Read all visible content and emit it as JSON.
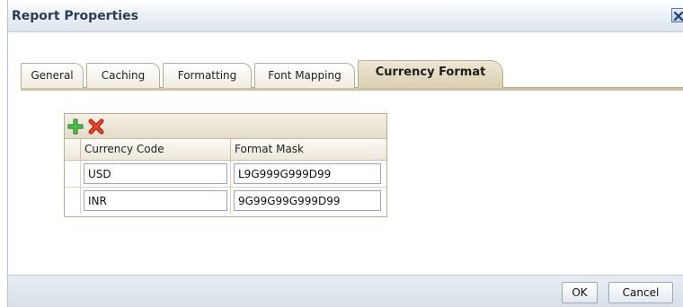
{
  "dialog": {
    "title": "Report Properties",
    "close_icon": "close-icon"
  },
  "tabs": [
    {
      "label": "General",
      "active": false
    },
    {
      "label": "Caching",
      "active": false
    },
    {
      "label": "Formatting",
      "active": false
    },
    {
      "label": "Font Mapping",
      "active": false
    },
    {
      "label": "Currency Format",
      "active": true
    }
  ],
  "grid": {
    "toolbar": {
      "add_icon": "add-icon",
      "delete_icon": "delete-icon"
    },
    "columns": [
      "Currency Code",
      "Format Mask"
    ],
    "rows": [
      {
        "currency_code": "USD",
        "format_mask": "L9G999G999D99"
      },
      {
        "currency_code": "INR",
        "format_mask": "9G99G99G999D99"
      }
    ]
  },
  "footer": {
    "ok_label": "OK",
    "cancel_label": "Cancel"
  },
  "colors": {
    "title_text": "#2b3d55",
    "add_icon": "#3aa53a",
    "delete_icon": "#d9371c",
    "tab_active_bg": "#d9ceb1"
  }
}
